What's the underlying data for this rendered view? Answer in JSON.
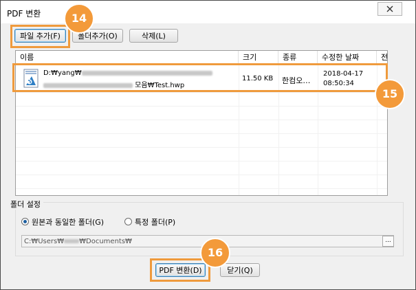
{
  "window": {
    "title": "PDF 변환",
    "close_icon": "close-icon"
  },
  "toolbar": {
    "add_file_label": "파일 추가(F)",
    "add_folder_label": "폴더추가(O)",
    "delete_label": "삭제(L)"
  },
  "file_list": {
    "columns": [
      "이름",
      "크기",
      "종류",
      "수정한 날짜",
      "전"
    ],
    "rows": [
      {
        "icon": "hwp-file-icon",
        "name_line1_prefix": "D:₩yang₩",
        "name_line2_suffix": " 모음₩Test.hwp",
        "size": "11.50 KB",
        "type": "한컴오…",
        "modified_date": "2018-04-17",
        "modified_time": "08:50:34"
      }
    ]
  },
  "folder_settings": {
    "group_label": "폴더 설정",
    "option_same": "원본과 동일한 폴더(G)",
    "option_specific": "특정 폴더(P)",
    "selected": "option_same",
    "path_prefix": "C:₩Users₩",
    "path_suffix": "₩Documents₩",
    "browse_label": "..."
  },
  "actions": {
    "convert_label": "PDF 변환(D)",
    "close_label": "닫기(Q)"
  },
  "callouts": {
    "badge_14": "14",
    "badge_15": "15",
    "badge_16": "16",
    "accent_color": "#f39a3a"
  }
}
